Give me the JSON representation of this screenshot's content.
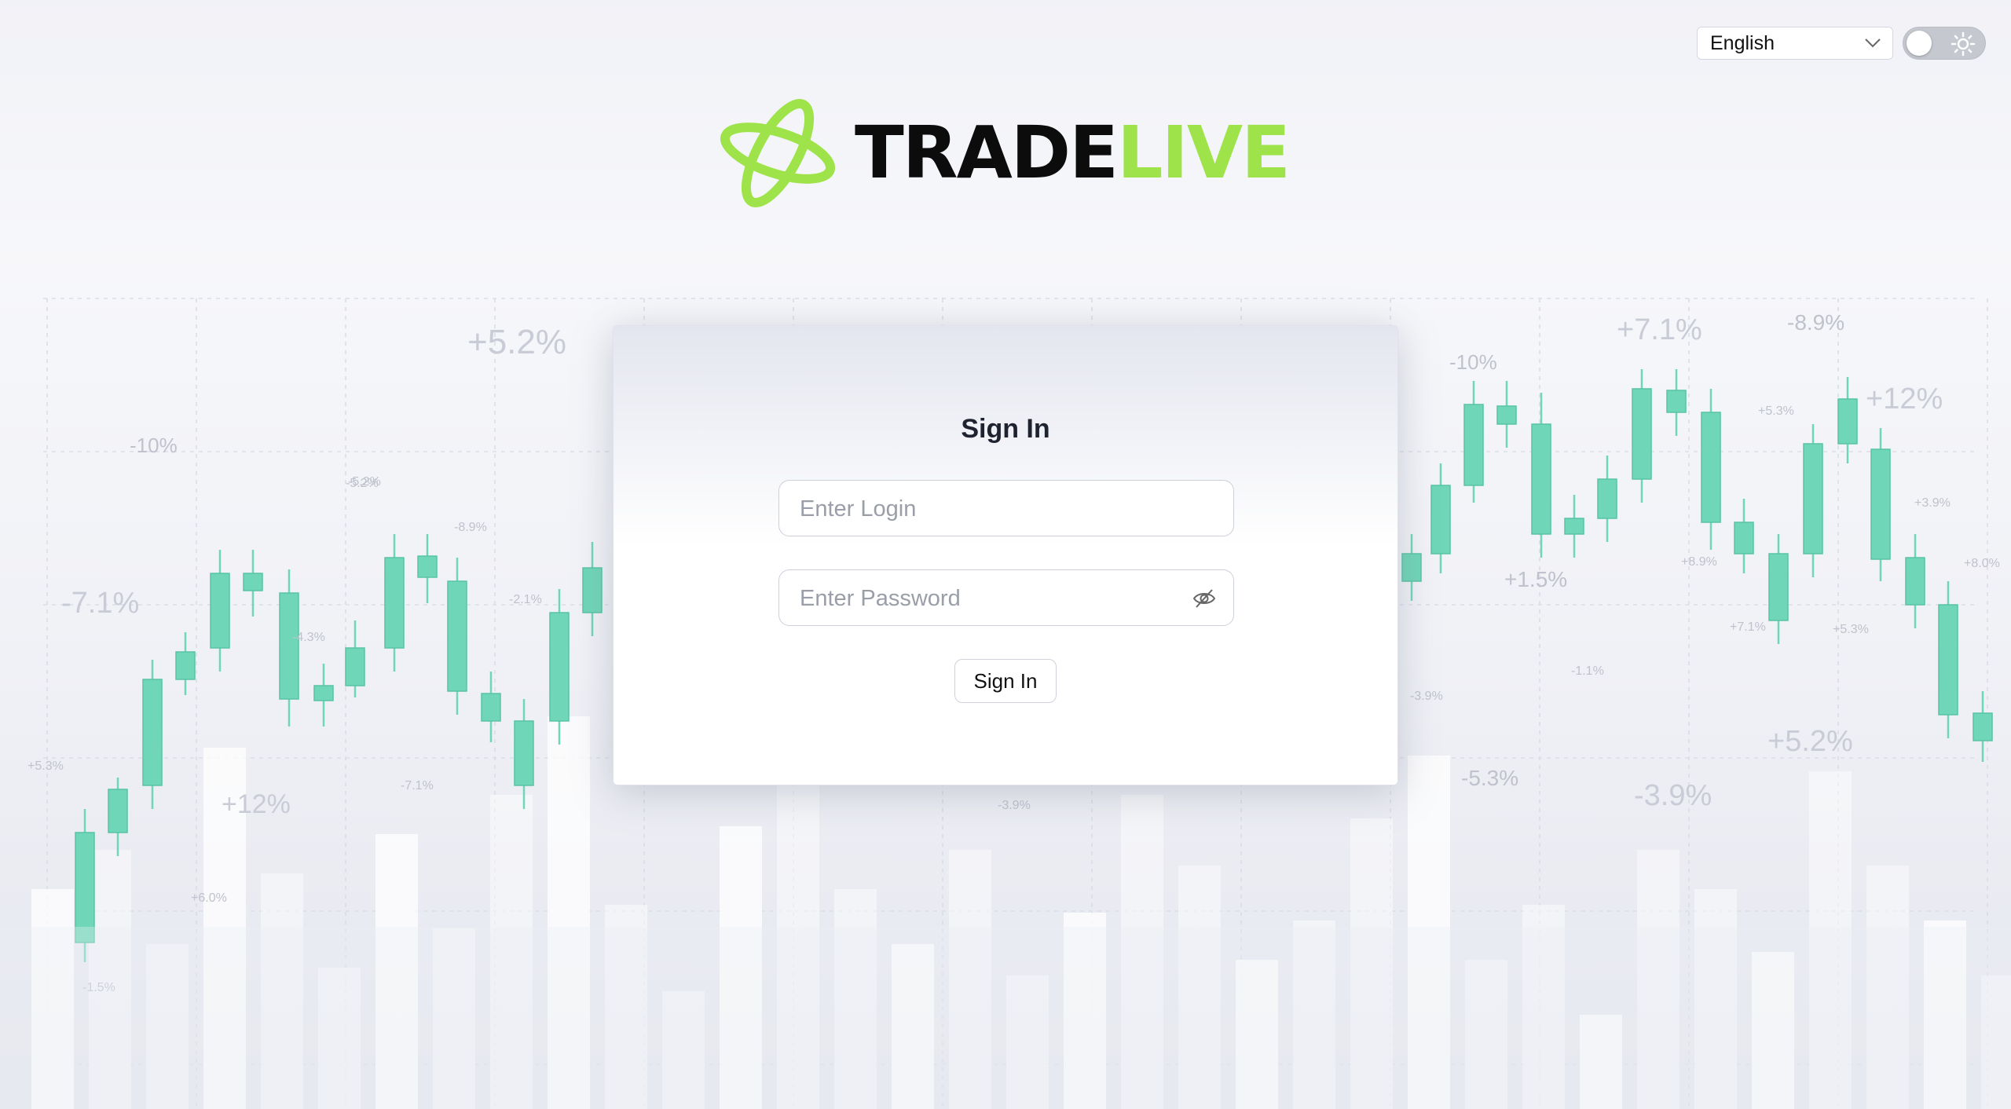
{
  "header": {
    "language": {
      "selected": "English"
    },
    "theme_toggle": {
      "state": "light",
      "icon": "sun-icon"
    }
  },
  "brand": {
    "word_dark": "TRADE",
    "word_light": "LIVE",
    "colors": {
      "dark": "#0c0c0c",
      "accent": "#9fe34a"
    }
  },
  "login_card": {
    "title": "Sign In",
    "login_placeholder": "Enter Login",
    "password_placeholder": "Enter Password",
    "submit_label": "Sign In"
  },
  "background": {
    "candle_colors": {
      "up": "#6fd6b7",
      "down": "#e89b9b"
    },
    "labels": [
      "+5.2%",
      "-10%",
      "-7.1%",
      "+12%",
      "-5.2%",
      "-8.9%",
      "-4.3%",
      "-3.9%",
      "+5.3%",
      "+6.0%",
      "-1.5%",
      "-7.1%",
      "+7.1%",
      "-8.9%",
      "+12%",
      "-10%",
      "+5.3%",
      "+3.9%",
      "+8.0%",
      "+8.9%",
      "+7.1%",
      "+5.3%",
      "-1.1%",
      "-3.9%",
      "-5.3%",
      "+5.2%",
      "-3.9%",
      "-2.1%",
      "-5.2%",
      "+1.5%"
    ]
  }
}
